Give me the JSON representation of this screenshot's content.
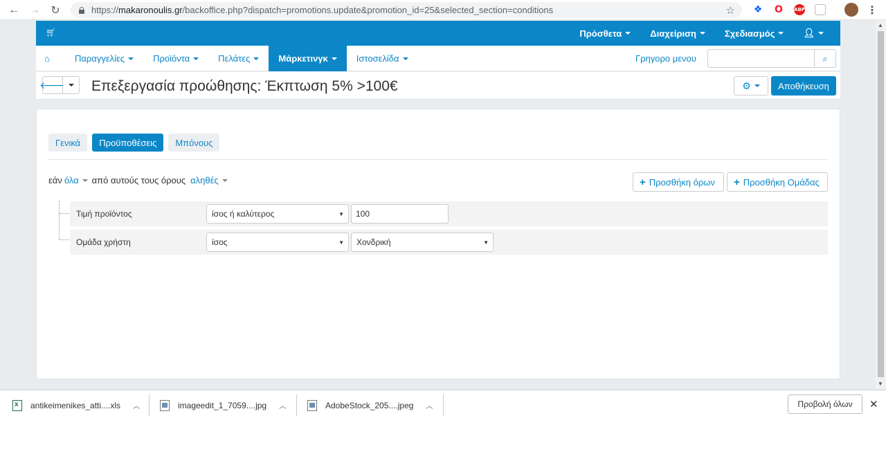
{
  "browser": {
    "url_prefix": "https://",
    "url_host": "makaronoulis.gr",
    "url_path": "/backoffice.php?dispatch=promotions.update&promotion_id=25&selected_section=conditions"
  },
  "top_nav": {
    "items": [
      {
        "label": "Πρόσθετα"
      },
      {
        "label": "Διαχείριση"
      },
      {
        "label": "Σχεδιασμός"
      }
    ]
  },
  "sub_nav": {
    "items": [
      {
        "label": "Παραγγελίες"
      },
      {
        "label": "Προϊόντα"
      },
      {
        "label": "Πελάτες"
      },
      {
        "label": "Μάρκετινγκ"
      },
      {
        "label": "Ιστοσελίδα"
      }
    ],
    "quick_menu": "Γρηγορο μενου",
    "search_value": ""
  },
  "title_bar": {
    "title": "Επεξεργασία προώθησης: Έκπτωση 5% >100€",
    "save_label": "Αποθήκευση"
  },
  "tabs": [
    {
      "label": "Γενικά"
    },
    {
      "label": "Προϋποθέσεις"
    },
    {
      "label": "Μπόνους"
    }
  ],
  "conditions": {
    "prefix": "εάν",
    "all_link": "όλα",
    "middle": "από αυτούς τους όρους",
    "true_link": "αληθές",
    "add_condition": "Προσθήκη όρων",
    "add_group": "Προσθήκη Ομάδας",
    "rows": [
      {
        "label": "Τιμή προϊόντος",
        "operator": "ίσος ή καλύτερος",
        "value": "100"
      },
      {
        "label": "Ομάδα χρήστη",
        "operator": "ίσος",
        "value": "Χονδρική"
      }
    ]
  },
  "downloads": {
    "items": [
      {
        "name": "antikeimenikes_atti....xls"
      },
      {
        "name": "imageedit_1_7059....jpg"
      },
      {
        "name": "AdobeStock_205....jpeg"
      }
    ],
    "show_all": "Προβολή όλων"
  },
  "colors": {
    "primary": "#0b87c8",
    "page_bg": "#e9ecef"
  }
}
